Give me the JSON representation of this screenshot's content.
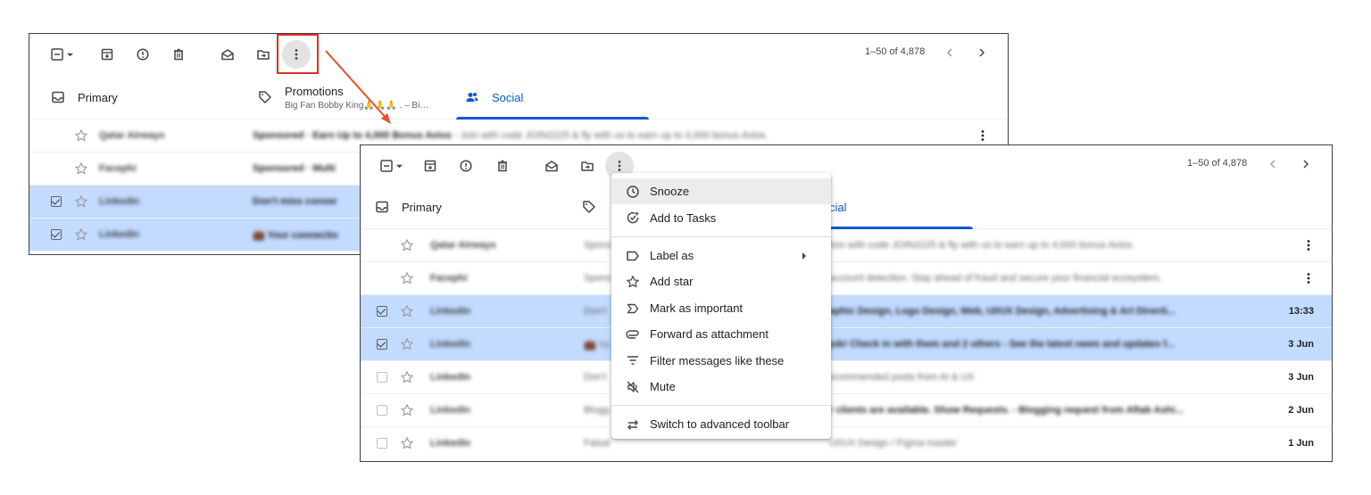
{
  "toolbar": {
    "pagination": "1–50 of 4,878",
    "icons": [
      "select-checkbox-icon",
      "archive-icon",
      "report-spam-icon",
      "delete-icon",
      "mark-as-read-icon",
      "move-to-icon",
      "more-options-icon",
      "prev-page-icon",
      "next-page-icon"
    ]
  },
  "tabs": {
    "primary": "Primary",
    "promotions": "Promotions",
    "promotions_sub": "Big Fan Bobby King🙏🙏🙏 . – Bi…",
    "social": "Social",
    "social_partial": "cial"
  },
  "back_window_rows": [
    {
      "sender": "Qatar Airways",
      "snippet_bold": "Sponsored · Earn Up to 4,000 Bonus Avios",
      "snippet": " - Join with code JOIN2225 & fly with us to earn up to 4,000 bonus Avios.",
      "selected": false,
      "checkbox": false
    },
    {
      "sender": "Facephi",
      "snippet_bold": "Sponsored · Multi",
      "snippet": "",
      "selected": false,
      "checkbox": false
    },
    {
      "sender": "LinkedIn",
      "snippet_bold": "Don't miss conver",
      "snippet": "",
      "selected": true,
      "checkbox": true
    },
    {
      "sender": "LinkedIn",
      "snippet_bold": "💼 Your connectio",
      "snippet": "",
      "selected": true,
      "checkbox": true
    }
  ],
  "front_window_rows": [
    {
      "sender": "Qatar Airways",
      "snippet": "Spons",
      "right_snippet": "tion with code JOIN2225 & fly with us to earn up to 4,000 bonus Avios.",
      "date": "",
      "selected": false,
      "checkbox": false
    },
    {
      "sender": "Facephi",
      "snippet": "Spons",
      "right_snippet": "account detection. Stay ahead of fraud and secure your financial ecosystem.",
      "date": "",
      "selected": false,
      "checkbox": false
    },
    {
      "sender": "LinkedIn",
      "snippet": "Don't",
      "right_snippet": "aphic Design, Logo Design, Web, UI/UX Design, Advertising & Art Directi...",
      "date": "13:33",
      "selected": true,
      "checkbox": true
    },
    {
      "sender": "LinkedIn",
      "snippet": "💼 Yo",
      "right_snippet": "job! Check in with them and 2 others - See the latest news and updates f...",
      "date": "3 Jun",
      "selected": true,
      "checkbox": true
    },
    {
      "sender": "LinkedIn",
      "snippet": "Don't",
      "right_snippet": "ecommended posts from AI & UX",
      "date": "3 Jun",
      "selected": false,
      "checkbox": false
    },
    {
      "sender": "LinkedIn",
      "snippet": "Blogg",
      "right_snippet": "r clients are available. Show Requests. - Blogging request from Aftab Ashi...",
      "date": "2 Jun",
      "selected": false,
      "checkbox": false
    },
    {
      "sender": "LinkedIn",
      "snippet": "Faisal",
      "right_snippet": "UI/UX Design / Figma master",
      "date": "1 Jun",
      "selected": false,
      "checkbox": false
    }
  ],
  "menu": {
    "items": [
      {
        "label": "Snooze",
        "icon": "clock-icon"
      },
      {
        "label": "Add to Tasks",
        "icon": "add-task-icon"
      },
      {
        "label": "Label as",
        "icon": "label-icon"
      },
      {
        "label": "Add star",
        "icon": "star-icon"
      },
      {
        "label": "Mark as important",
        "icon": "important-icon"
      },
      {
        "label": "Forward as attachment",
        "icon": "attachment-icon"
      },
      {
        "label": "Filter messages like these",
        "icon": "filter-icon"
      },
      {
        "label": "Mute",
        "icon": "mute-icon"
      },
      {
        "label": "Switch to advanced toolbar",
        "icon": "switch-icon"
      }
    ]
  },
  "colors": {
    "accent": "#0b57d0",
    "selected_row": "#c2dbff",
    "highlight": "#d93025"
  }
}
